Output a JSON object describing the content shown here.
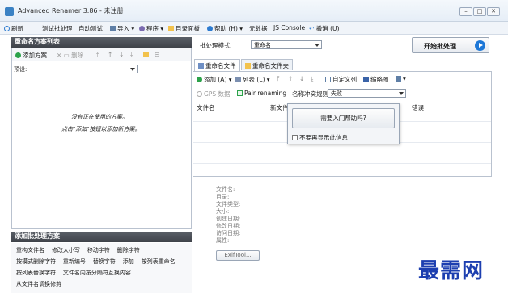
{
  "window": {
    "title": "Advanced Renamer 3.86 - 未注册"
  },
  "toolbar": {
    "refresh": "刷新",
    "test_batch": "测试批处理",
    "auto_test": "自动测试",
    "import": "导入",
    "program": "程序",
    "dir_panel": "目录面板",
    "help": "帮助 (H)",
    "metadata": "元数据",
    "js_console": "JS Console",
    "undo": "撤消 (U)"
  },
  "left": {
    "methods_header": "重命名方案列表",
    "add_method": "添加方案",
    "delete": "删除",
    "preset_label": "预设:",
    "empty_line1": "没有正在使用的方案。",
    "empty_line2": "点击\"添加\"按钮以添加新方案。",
    "add_header": "添加批处理方案",
    "methods": [
      [
        "重构文件名",
        "修改大小写",
        "移动字符",
        "删除字符"
      ],
      [
        "按模式删除字符",
        "重新编号",
        "替换字符",
        "添加",
        "按列表重命名"
      ],
      [
        "按列表替换字符",
        "文件名内按分隔符互换内容"
      ],
      [
        "从文件名调换修剪"
      ]
    ]
  },
  "right": {
    "batch_mode_label": "批处理模式",
    "batch_mode_value": "重命名",
    "start_button": "开始批处理",
    "tab_files": "重命名文件",
    "tab_folders": "重命名文件夹",
    "add": "添加 (A)",
    "list": "列表 (L)",
    "custom_columns": "自定义列",
    "thumbnails": "缩略图",
    "gps": "GPS 数据",
    "pair_renaming": "Pair renaming",
    "name_conflict_label": "名称冲突规则:",
    "name_conflict_value": "失败",
    "columns": [
      "文件名",
      "新文件名",
      "",
      "错误"
    ],
    "popup_button": "需要入门帮助吗?",
    "popup_checkbox": "不要再显示此信息",
    "info_labels": [
      "文件名:",
      "目录:",
      "文件类型:",
      "大小:",
      "创建日期:",
      "修改日期:",
      "访问日期:",
      "属性:"
    ],
    "exif_button": "ExifTool..."
  },
  "watermark": "最需网",
  "colors": {
    "accent": "#1e78d7",
    "header_dark": "#4a4f56",
    "watermark": "#1d3fb0"
  }
}
